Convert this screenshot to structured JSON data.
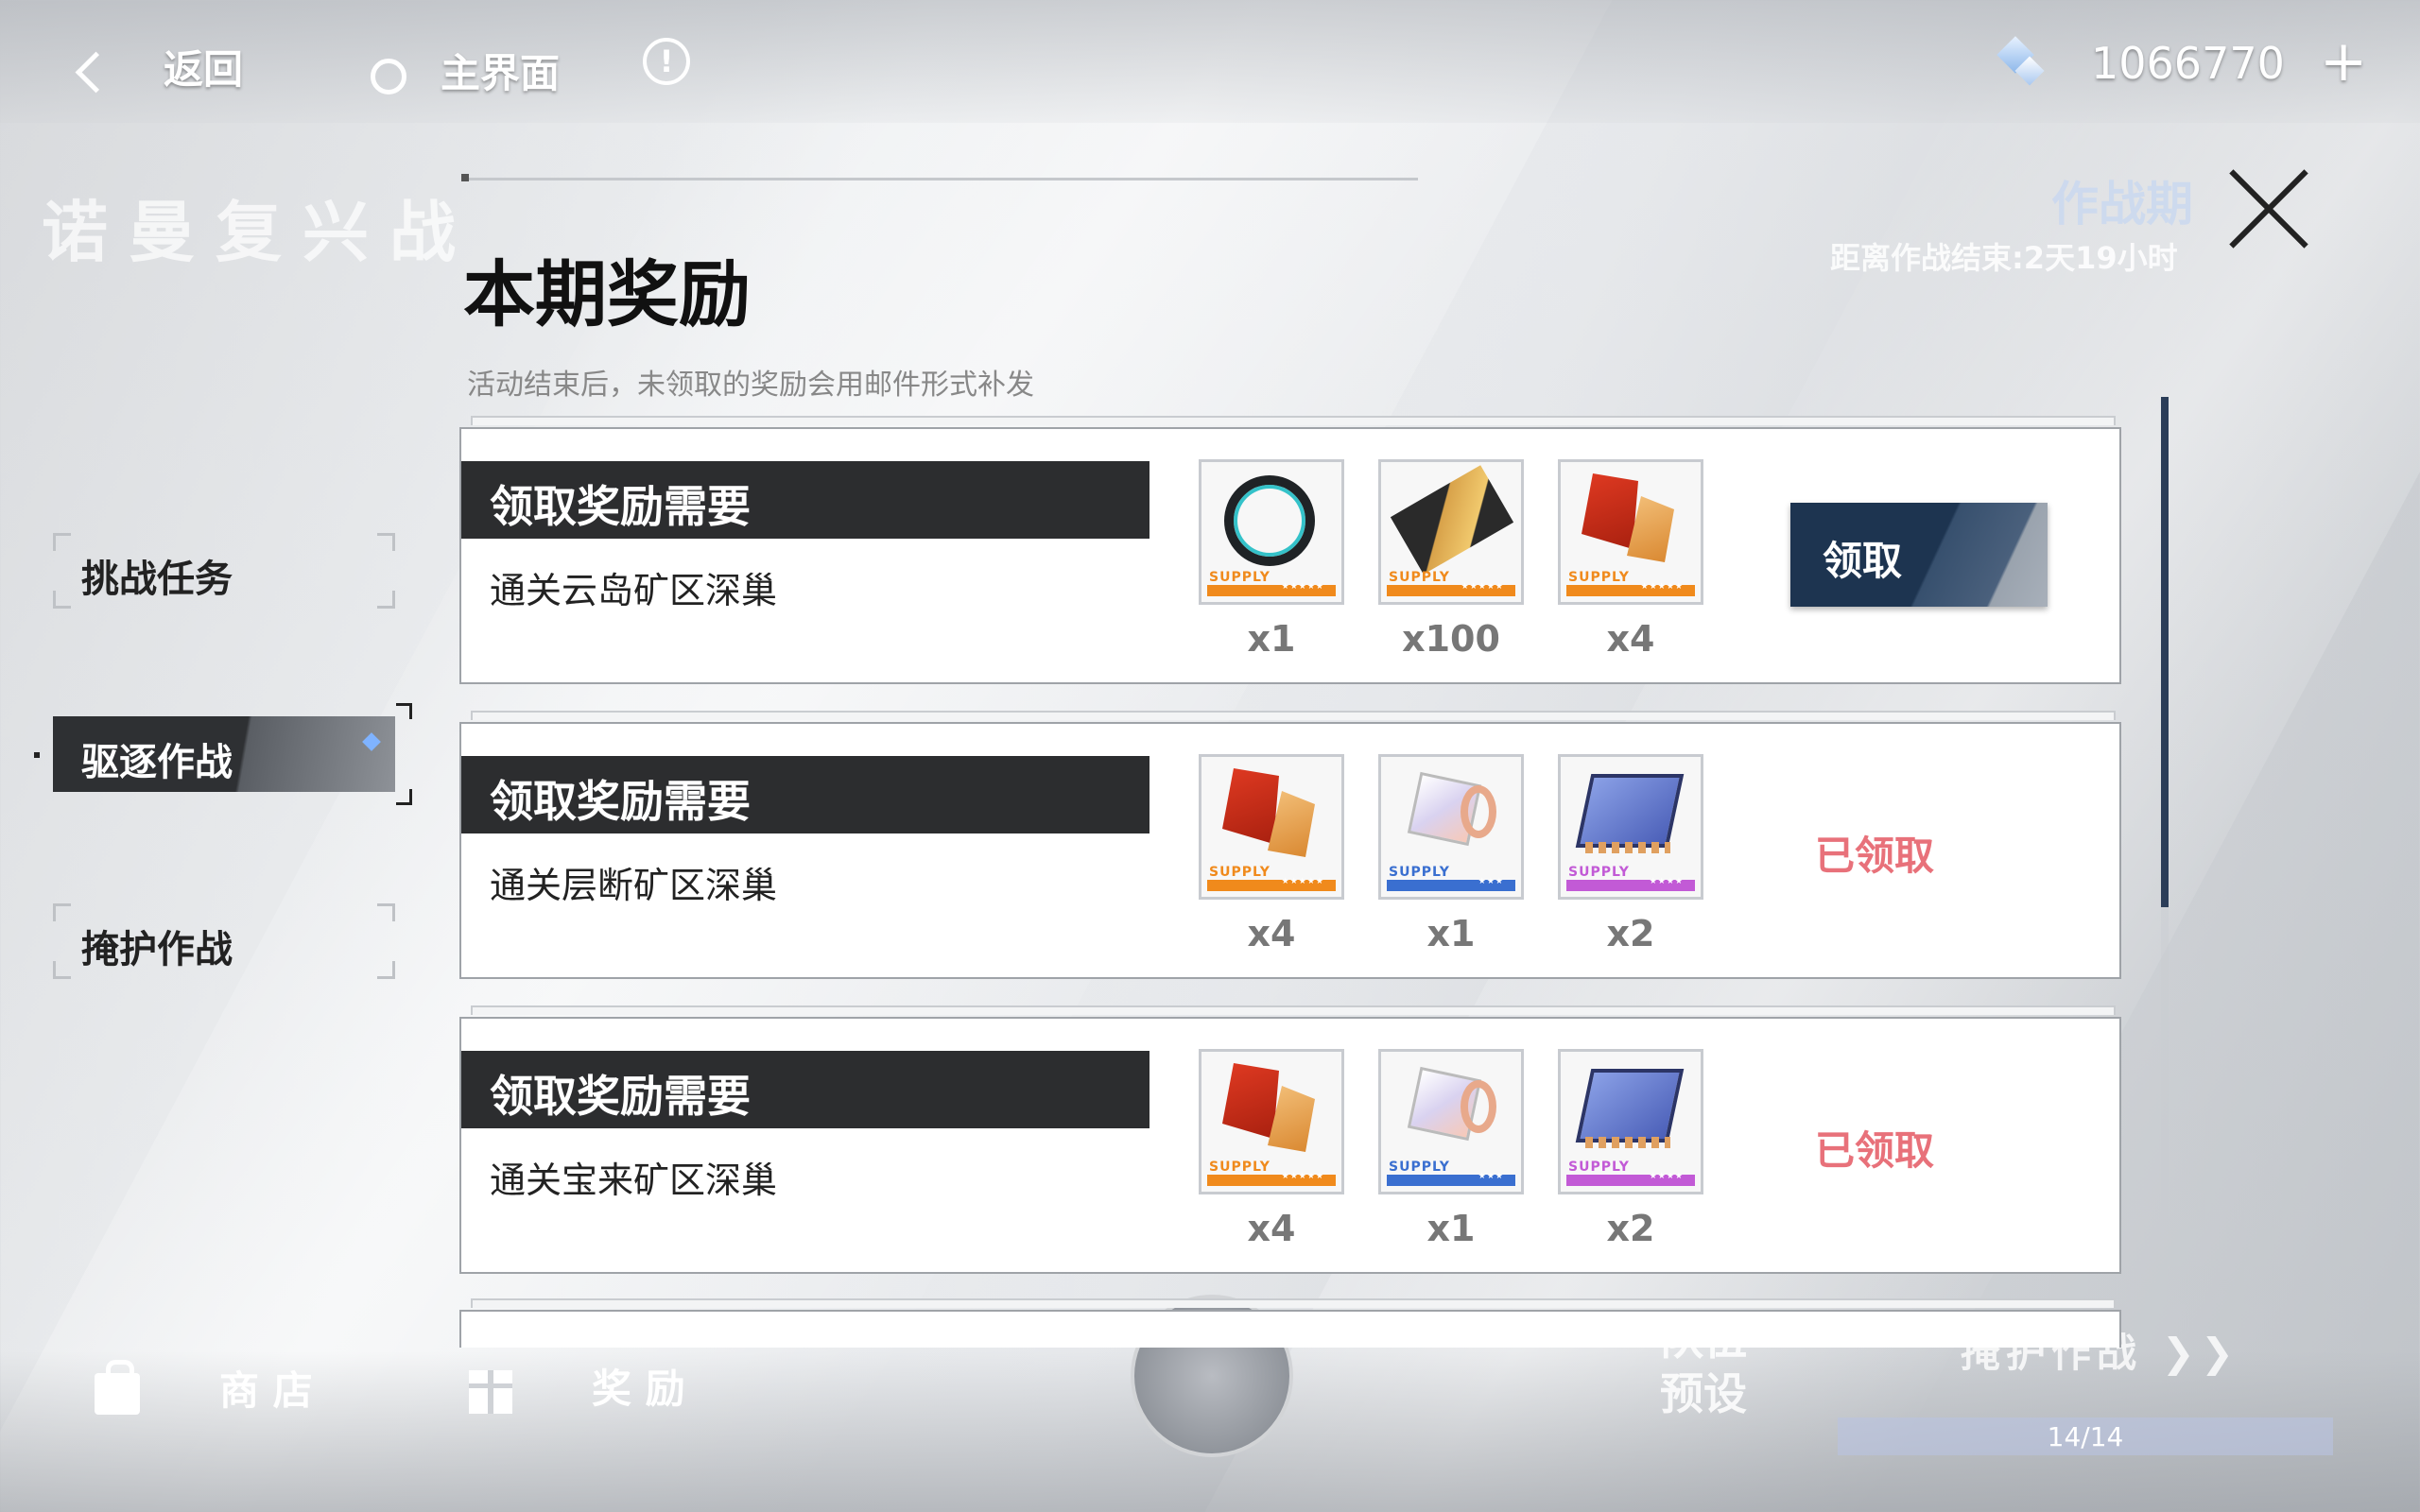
{
  "topbar": {
    "back_label": "返回",
    "home_label": "主界面",
    "currency_value": "1066770",
    "add_label": "+"
  },
  "background": {
    "event_title": "诺曼复兴战",
    "period_label": "作战期",
    "period_remaining": "距离作战结束:2天19小时",
    "dispatch_label": "掩护作战",
    "dispatch_progress": "14/14",
    "team_preset_line1": "队伍",
    "team_preset_line2": "预设"
  },
  "side_tabs": [
    {
      "label": "挑战任务",
      "active": false
    },
    {
      "label": "驱逐作战",
      "active": true
    },
    {
      "label": "掩护作战",
      "active": false
    }
  ],
  "bottom_nav": {
    "shop_label": "商 店",
    "reward_label": "奖 励"
  },
  "panel": {
    "title": "本期奖励",
    "subtitle": "活动结束后，未领取的奖励会用邮件形式补发",
    "close_icon": "close-icon"
  },
  "rewards": [
    {
      "header": "领取奖励需要",
      "requirement": "通关云岛矿区深巢",
      "items": [
        {
          "icon": "ring-icon",
          "rarity_color": "#f08a1c",
          "supply": "SUPPLY",
          "stars": "★★★★★",
          "qty": "x1"
        },
        {
          "icon": "gold-card-icon",
          "rarity_color": "#f08a1c",
          "supply": "SUPPLY",
          "stars": "★★★★★",
          "qty": "x100"
        },
        {
          "icon": "red-crystal-icon",
          "rarity_color": "#f08a1c",
          "supply": "SUPPLY",
          "stars": "★★★★★",
          "qty": "x4"
        }
      ],
      "action": "领取",
      "status": ""
    },
    {
      "header": "领取奖励需要",
      "requirement": "通关层断矿区深巢",
      "items": [
        {
          "icon": "red-crystal-icon",
          "rarity_color": "#f08a1c",
          "supply": "SUPPLY",
          "stars": "★★★★★",
          "qty": "x4"
        },
        {
          "icon": "crystal-cube-icon",
          "rarity_color": "#3a6fd0",
          "supply": "SUPPLY",
          "stars": "★★★",
          "qty": "x1"
        },
        {
          "icon": "chip-icon",
          "rarity_color": "#c25ad6",
          "supply": "SUPPLY",
          "stars": "★★★★",
          "qty": "x2"
        }
      ],
      "action": "",
      "status": "已领取"
    },
    {
      "header": "领取奖励需要",
      "requirement": "通关宝来矿区深巢",
      "items": [
        {
          "icon": "red-crystal-icon",
          "rarity_color": "#f08a1c",
          "supply": "SUPPLY",
          "stars": "★★★★★",
          "qty": "x4"
        },
        {
          "icon": "crystal-cube-icon",
          "rarity_color": "#3a6fd0",
          "supply": "SUPPLY",
          "stars": "★★★",
          "qty": "x1"
        },
        {
          "icon": "chip-icon",
          "rarity_color": "#c25ad6",
          "supply": "SUPPLY",
          "stars": "★★★★",
          "qty": "x2"
        }
      ],
      "action": "",
      "status": "已领取"
    }
  ]
}
